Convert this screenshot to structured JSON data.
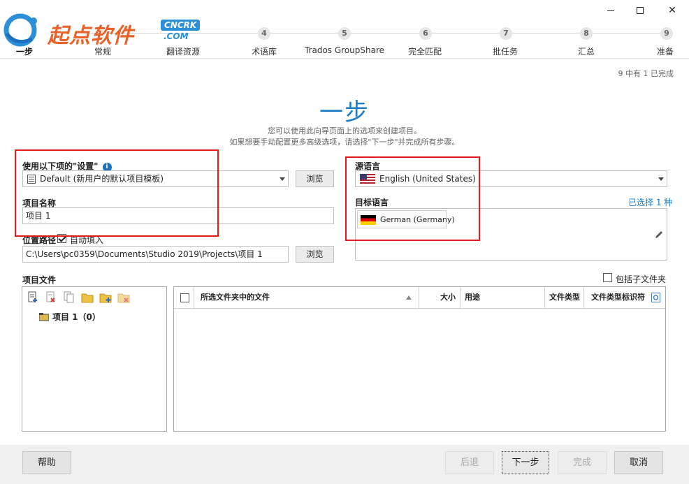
{
  "window": {
    "minimize": "",
    "maximize": "",
    "close": "✕"
  },
  "watermark": {
    "brand": "起点软件",
    "badge": "CNCRK",
    "com": ".COM"
  },
  "steps": [
    {
      "num": "1",
      "label": "一步"
    },
    {
      "num": "2",
      "label": "常规"
    },
    {
      "num": "3",
      "label": "翻译资源"
    },
    {
      "num": "4",
      "label": "术语库"
    },
    {
      "num": "5",
      "label": "Trados GroupShare"
    },
    {
      "num": "6",
      "label": "完全匹配"
    },
    {
      "num": "7",
      "label": "批任务"
    },
    {
      "num": "8",
      "label": "汇总"
    },
    {
      "num": "9",
      "label": "准备"
    }
  ],
  "progress_text": "9 中有 1 已完成",
  "page": {
    "title": "一步",
    "subtitle1": "您可以使用此向导页面上的选项来创建项目。",
    "subtitle2": "如果想要手动配置更多高级选项，请选择\"下一步\"并完成所有步骤。"
  },
  "settings": {
    "label": "使用以下项的\"设置\"",
    "value": "Default (新用户的默认项目模板)",
    "browse": "浏览"
  },
  "project_name": {
    "label": "项目名称",
    "value": "项目 1"
  },
  "location": {
    "label": "位置路径",
    "auto_fill": "自动填入",
    "auto_fill_checked": true,
    "value": "C:\\Users\\pc0359\\Documents\\Studio 2019\\Projects\\项目 1",
    "browse": "浏览"
  },
  "source_language": {
    "label": "源语言",
    "value": "English (United States)"
  },
  "target_language": {
    "label": "目标语言",
    "selected_count": "已选择 1 种",
    "items": [
      "German (Germany)"
    ]
  },
  "project_files": {
    "label": "项目文件",
    "include_subfolders": "包括子文件夹",
    "include_subfolders_checked": false,
    "tree_root": "项目 1（0）",
    "columns": {
      "files": "所选文件夹中的文件",
      "size": "大小",
      "usage": "用途",
      "file_type": "文件类型",
      "file_type_id": "文件类型标识符"
    }
  },
  "footer": {
    "help": "帮助",
    "back": "后退",
    "next": "下一步",
    "finish": "完成",
    "cancel": "取消"
  },
  "colors": {
    "accent": "#1d7ec7",
    "highlight_box": "#e21a1a",
    "watermark_orange": "#e8622a"
  }
}
